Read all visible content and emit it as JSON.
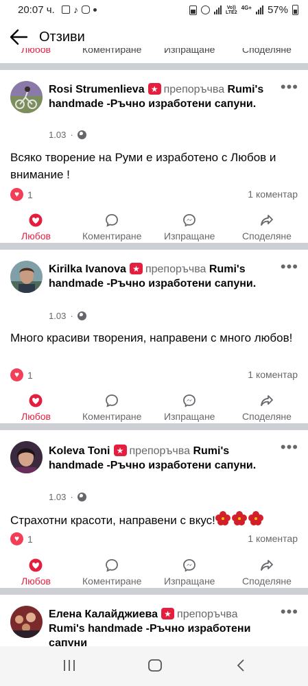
{
  "status_bar": {
    "time": "20:07 ч.",
    "battery": "57%",
    "network_top": "Vo))",
    "network_bottom": "LTE2",
    "network_type": "4G+"
  },
  "header": {
    "title": "Отзиви"
  },
  "top_actions": {
    "like": "Любов",
    "comment": "Коментиране",
    "send": "Изпращане",
    "share": "Споделяне"
  },
  "labels": {
    "recommends": "препоръчва",
    "like": "Любов",
    "comment": "Коментиране",
    "send": "Изпращане",
    "share": "Споделяне"
  },
  "posts": [
    {
      "author": "Rosi Strumenlieva",
      "page": "Rumi's handmade -Ръчно изработени сапуни",
      "date": "1.03",
      "text": "Всяко творение на Руми е изработено с Любов и внимание !",
      "reactions": "1",
      "comments": "1 коментар",
      "liked": true
    },
    {
      "author": "Kirilka Ivanova",
      "page": "Rumi's handmade -Ръчно изработени сапуни",
      "date": "1.03",
      "text": "Много красиви творения, направени с много любов!",
      "reactions": "1",
      "comments": "1 коментар",
      "liked": true
    },
    {
      "author": "Koleva Toni",
      "page": "Rumi's handmade -Ръчно изработени сапуни",
      "date": "1.03",
      "text": "Страхотни красоти, направени с вкус!",
      "reactions": "1",
      "comments": "1 коментар",
      "liked": true
    },
    {
      "author": "Елена Калайджиева",
      "page": "Rumi's handmade -Ръчно изработени сапуни"
    }
  ],
  "colors": {
    "accent_red": "#e41e3f",
    "text_secondary": "#65676b",
    "divider": "#ccd0d5"
  },
  "icons": {
    "back": "arrow-left-icon",
    "more": "more-horizontal-icon",
    "love": "heart-icon",
    "comment": "comment-bubble-icon",
    "send": "messenger-icon",
    "share": "share-arrow-icon",
    "globe": "globe-icon"
  }
}
